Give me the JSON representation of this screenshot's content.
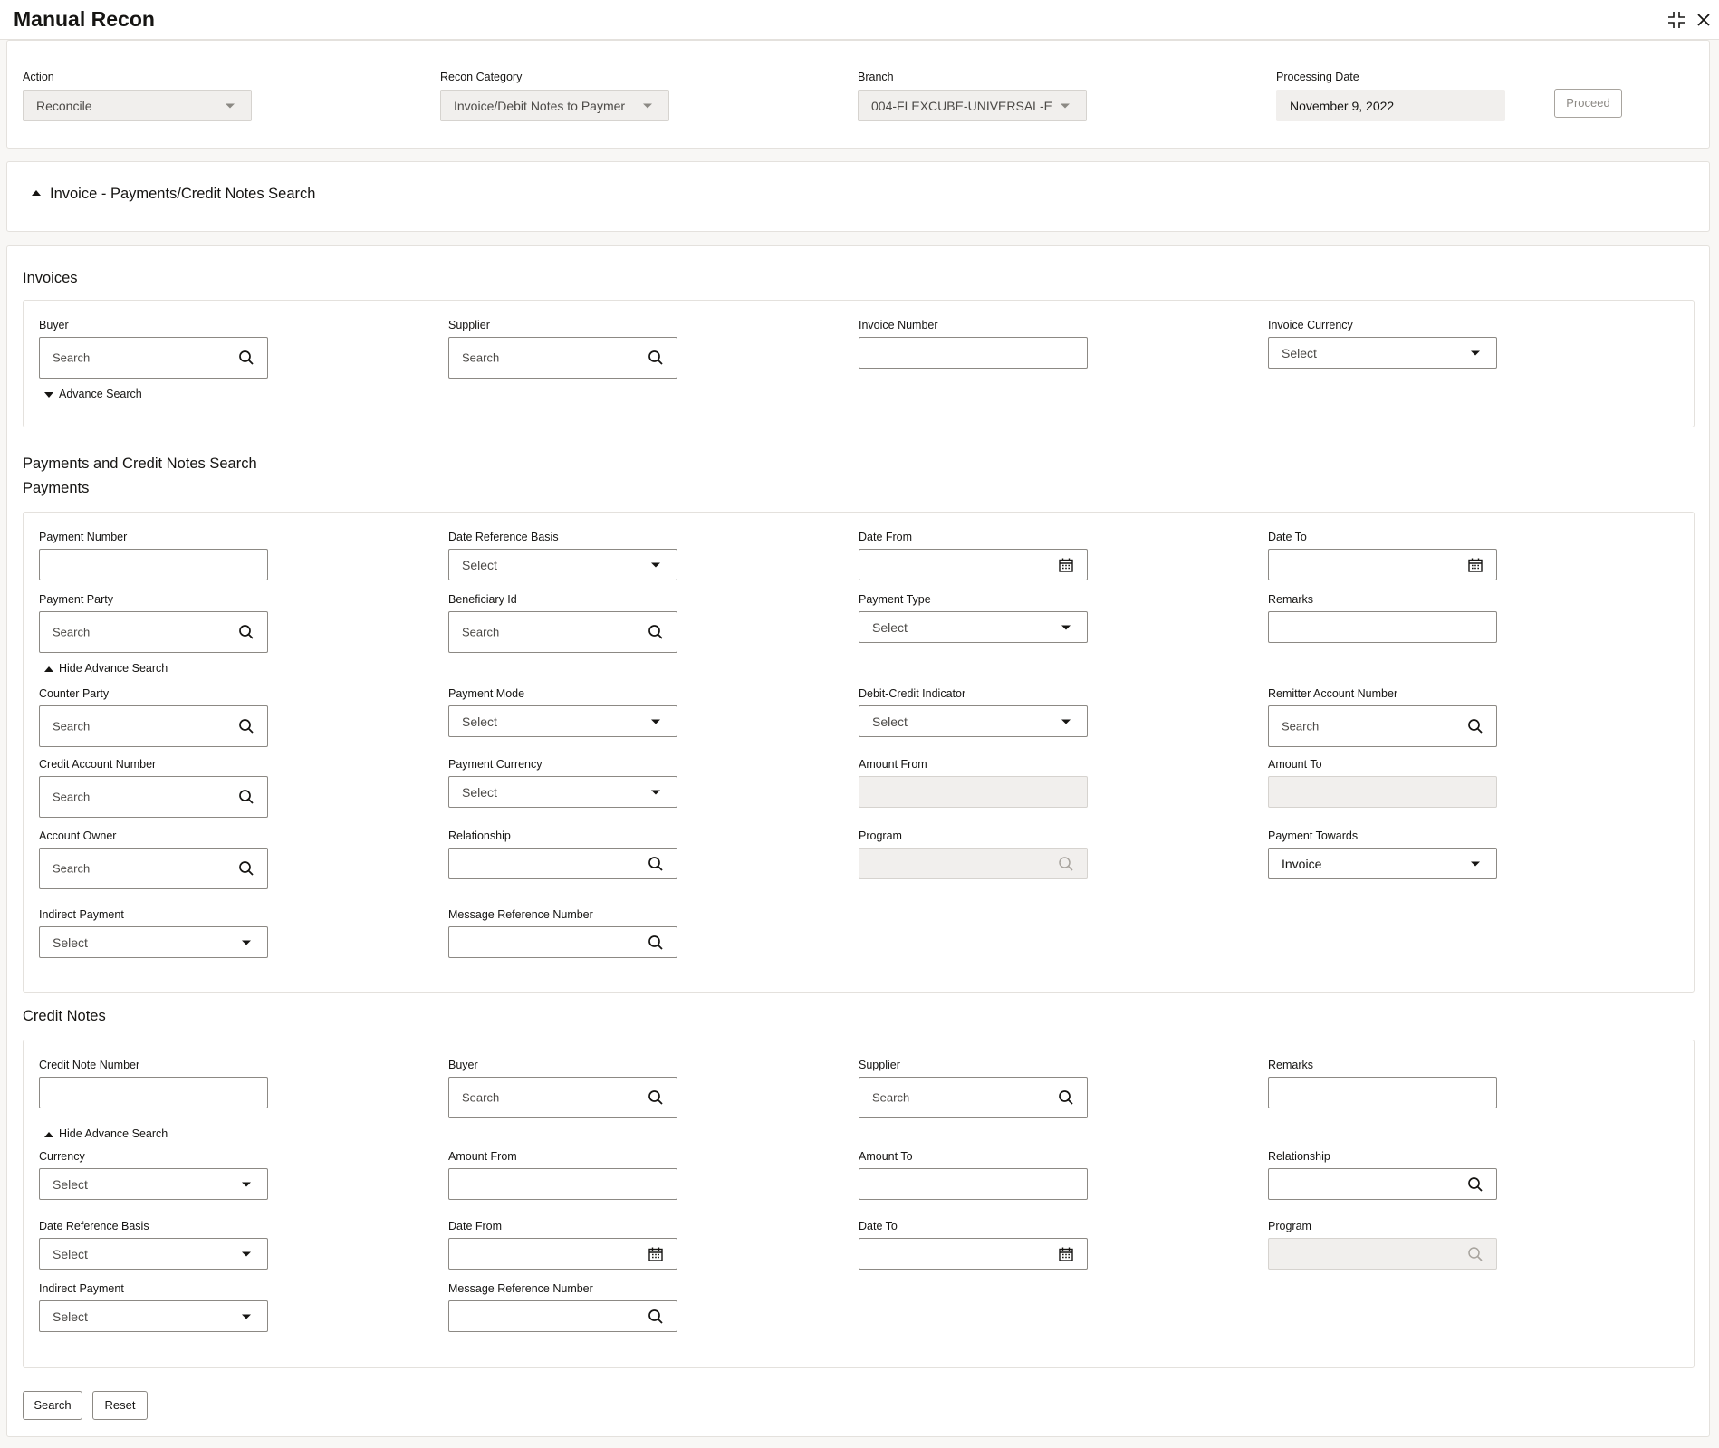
{
  "header": {
    "title": "Manual Recon"
  },
  "top": {
    "action_label": "Action",
    "action_value": "Reconcile",
    "recon_label": "Recon Category",
    "recon_value": "Invoice/Debit Notes to Paymer",
    "branch_label": "Branch",
    "branch_value": "004-FLEXCUBE-UNIVERSAL-E",
    "date_label": "Processing Date",
    "date_value": "November 9, 2022",
    "proceed": "Proceed"
  },
  "collapse": {
    "title": "Invoice - Payments/Credit Notes Search"
  },
  "invoices": {
    "title": "Invoices",
    "buyer_label": "Buyer",
    "buyer_ph": "Search",
    "supplier_label": "Supplier",
    "supplier_ph": "Search",
    "invoice_number_label": "Invoice Number",
    "invoice_currency_label": "Invoice Currency",
    "invoice_currency_value": "Select",
    "advance": "Advance Search"
  },
  "payments": {
    "section_title": "Payments and Credit Notes Search",
    "title": "Payments",
    "payment_number": "Payment Number",
    "date_ref_basis": "Date Reference Basis",
    "date_ref_basis_value": "Select",
    "date_from": "Date From",
    "date_to": "Date To",
    "payment_party": "Payment Party",
    "payment_party_ph": "Search",
    "beneficiary_id": "Beneficiary Id",
    "beneficiary_id_ph": "Search",
    "payment_type": "Payment Type",
    "payment_type_value": "Select",
    "remarks": "Remarks",
    "hide_advance": "Hide Advance Search",
    "counter_party": "Counter Party",
    "counter_party_ph": "Search",
    "payment_mode": "Payment Mode",
    "payment_mode_value": "Select",
    "debit_credit": "Debit-Credit Indicator",
    "debit_credit_value": "Select",
    "remitter_acc": "Remitter Account Number",
    "remitter_acc_ph": "Search",
    "credit_acc": "Credit Account Number",
    "credit_acc_ph": "Search",
    "payment_currency": "Payment Currency",
    "payment_currency_value": "Select",
    "amount_from": "Amount From",
    "amount_to": "Amount To",
    "account_owner": "Account Owner",
    "account_owner_ph": "Search",
    "relationship": "Relationship",
    "program": "Program",
    "payment_towards": "Payment Towards",
    "payment_towards_value": "Invoice",
    "indirect_payment": "Indirect Payment",
    "indirect_payment_value": "Select",
    "msg_ref": "Message Reference Number"
  },
  "credit_notes": {
    "title": "Credit Notes",
    "cn_number": "Credit Note Number",
    "buyer": "Buyer",
    "buyer_ph": "Search",
    "supplier": "Supplier",
    "supplier_ph": "Search",
    "remarks": "Remarks",
    "hide_advance": "Hide Advance Search",
    "currency": "Currency",
    "currency_value": "Select",
    "amount_from": "Amount From",
    "amount_to": "Amount To",
    "relationship": "Relationship",
    "date_ref_basis": "Date Reference Basis",
    "date_ref_basis_value": "Select",
    "date_from": "Date From",
    "date_to": "Date To",
    "program": "Program",
    "indirect_payment": "Indirect Payment",
    "indirect_payment_value": "Select",
    "msg_ref": "Message Reference Number"
  },
  "footer": {
    "search": "Search",
    "reset": "Reset"
  }
}
